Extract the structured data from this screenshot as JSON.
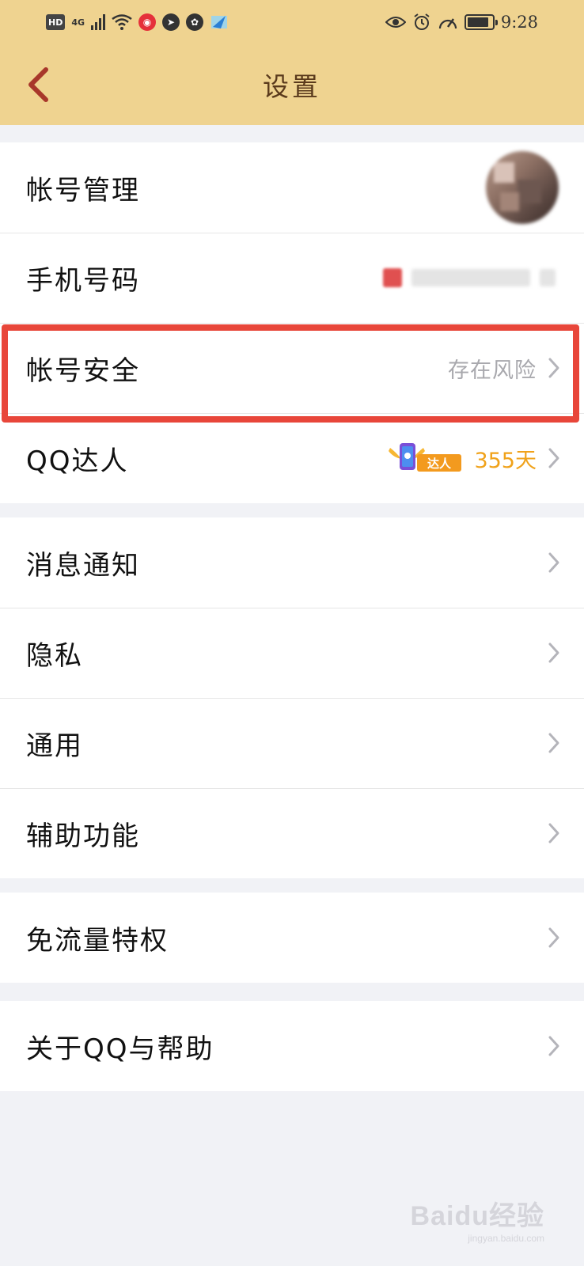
{
  "status_bar": {
    "hd": "HD",
    "network": "4G",
    "time": "9:28"
  },
  "header": {
    "title": "设置"
  },
  "groups": [
    {
      "items": [
        {
          "label": "帐号管理"
        },
        {
          "label": "手机号码"
        },
        {
          "label": "帐号安全",
          "value": "存在风险"
        },
        {
          "label": "QQ达人",
          "badge": "达人",
          "days": "355天"
        }
      ]
    },
    {
      "items": [
        {
          "label": "消息通知"
        },
        {
          "label": "隐私"
        },
        {
          "label": "通用"
        },
        {
          "label": "辅助功能"
        }
      ]
    },
    {
      "items": [
        {
          "label": "免流量特权"
        }
      ]
    },
    {
      "items": [
        {
          "label": "关于QQ与帮助"
        }
      ]
    }
  ],
  "watermark": {
    "text": "Baidu经验",
    "sub": "jingyan.baidu.com"
  },
  "colors": {
    "header_bg": "#efd390",
    "title_color": "#5a3a1c",
    "back_color": "#a8372a",
    "highlight": "#e8463a",
    "days_color": "#f0a21a"
  },
  "icons": [
    "hd-icon",
    "signal-icon",
    "wifi-icon",
    "app-notification-icon",
    "wechat-icon",
    "eye-icon",
    "alarm-icon",
    "speed-icon",
    "battery-icon",
    "back-chevron-icon",
    "chevron-right-icon",
    "qq-daren-icon"
  ]
}
